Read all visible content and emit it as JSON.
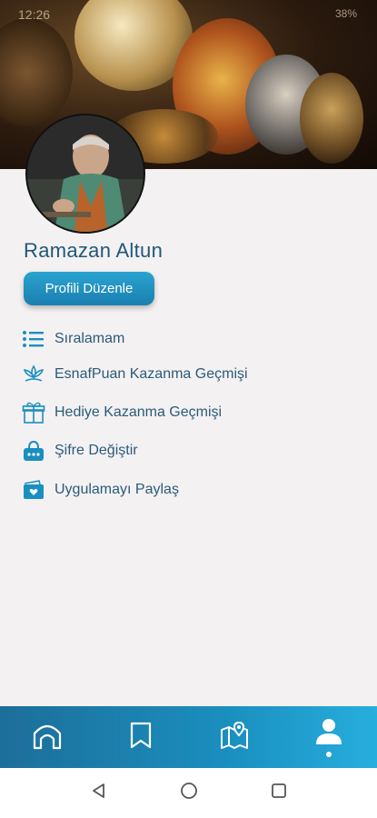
{
  "status_bar": {
    "time": "12:26",
    "right_text": "38%"
  },
  "profile": {
    "name": "Ramazan Altun",
    "edit_label": "Profili Düzenle"
  },
  "menu": [
    {
      "label": "Sıralamam",
      "icon": "list-icon"
    },
    {
      "label": "EsnafPuan Kazanma Geçmişi",
      "icon": "lotus-icon"
    },
    {
      "label": "Hediye Kazanma Geçmişi",
      "icon": "gift-icon"
    },
    {
      "label": "Şifre Değiştir",
      "icon": "lock-bag-icon"
    },
    {
      "label": "Uygulamayı Paylaş",
      "icon": "share-wallet-icon"
    }
  ],
  "bottom_nav": [
    {
      "name": "home",
      "icon": "home-icon"
    },
    {
      "name": "bookmarks",
      "icon": "bookmark-icon"
    },
    {
      "name": "map",
      "icon": "map-icon"
    },
    {
      "name": "profile",
      "icon": "person-icon",
      "active": true
    }
  ],
  "colors": {
    "accent": "#1a8fbf",
    "text": "#2a5b7a",
    "background": "#f4f1f2"
  }
}
